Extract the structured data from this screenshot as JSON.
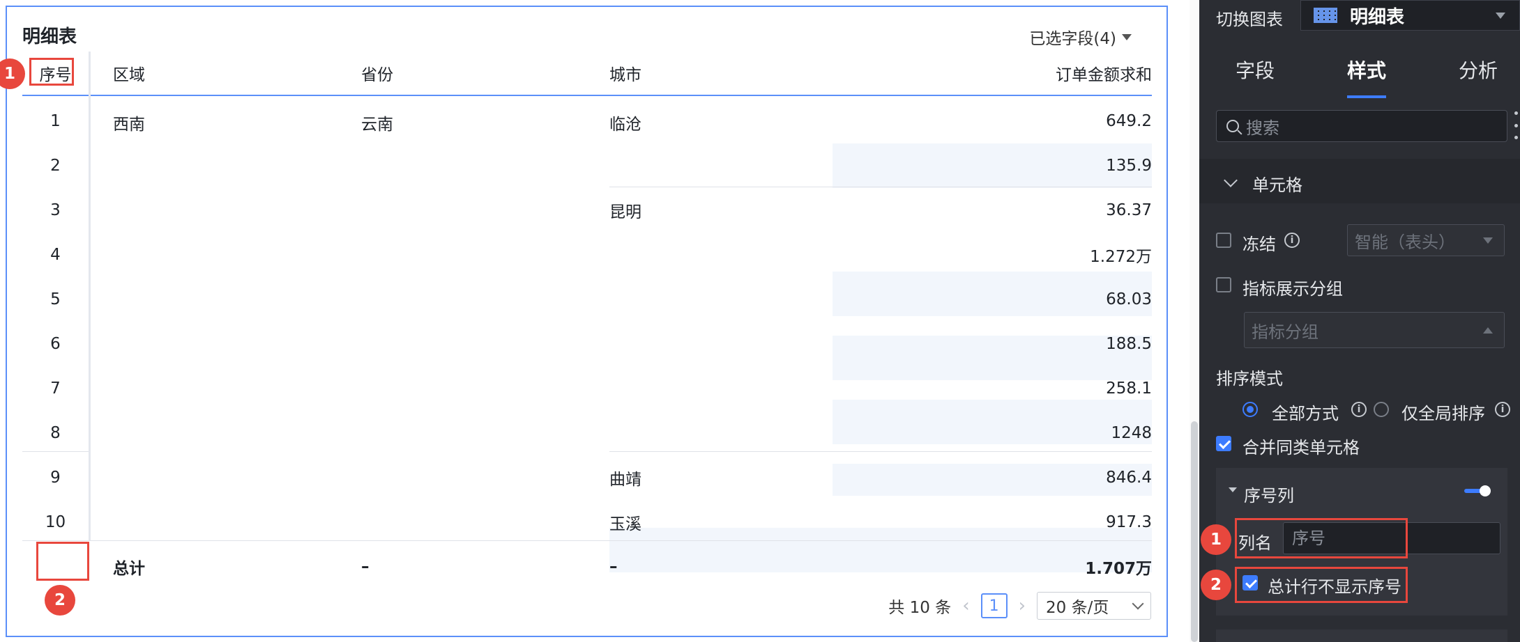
{
  "table": {
    "title": "明细表",
    "fields_selector": "已选字段(4)",
    "headers": {
      "index": "序号",
      "region": "区域",
      "province": "省份",
      "city": "城市",
      "amount": "订单金额求和"
    },
    "rows": [
      {
        "index": "1",
        "region": "西南",
        "province": "云南",
        "city": "临沧",
        "amount": "649.2"
      },
      {
        "index": "2",
        "region": "",
        "province": "",
        "city": "",
        "amount": "135.9"
      },
      {
        "index": "3",
        "region": "",
        "province": "",
        "city": "昆明",
        "amount": "36.37"
      },
      {
        "index": "4",
        "region": "",
        "province": "",
        "city": "",
        "amount": "1.272万"
      },
      {
        "index": "5",
        "region": "",
        "province": "",
        "city": "",
        "amount": "68.03"
      },
      {
        "index": "6",
        "region": "",
        "province": "",
        "city": "",
        "amount": "188.5"
      },
      {
        "index": "7",
        "region": "",
        "province": "",
        "city": "",
        "amount": "258.1"
      },
      {
        "index": "8",
        "region": "",
        "province": "",
        "city": "",
        "amount": "1248"
      },
      {
        "index": "9",
        "region": "",
        "province": "",
        "city": "曲靖",
        "amount": "846.4"
      },
      {
        "index": "10",
        "region": "",
        "province": "",
        "city": "玉溪",
        "amount": "917.3"
      }
    ],
    "total": {
      "label": "总计",
      "province": "–",
      "city": "–",
      "amount": "1.707万"
    },
    "pager": {
      "count": "共 10 条",
      "current": "1",
      "page_size": "20 条/页"
    }
  },
  "markers": {
    "one": "1",
    "two": "2"
  },
  "side": {
    "switch_label": "切换图表",
    "chart_type": "明细表",
    "tabs": [
      "字段",
      "样式",
      "分析"
    ],
    "search_placeholder": "搜索",
    "section": "单元格",
    "freeze_label": "冻结",
    "freeze_value": "智能（表头）",
    "metric_group_label": "指标展示分组",
    "metric_group_placeholder": "指标分组",
    "sort_mode_label": "排序模式",
    "sort_all": "全部方式",
    "sort_global": "仅全局排序",
    "merge_cells_label": "合并同类单元格",
    "index_col_label": "序号列",
    "col_name_label": "列名",
    "col_name_placeholder": "序号",
    "hide_total_index_label": "总计行不显示序号"
  },
  "colors": {
    "accent": "#3d7cff",
    "highlight": "#e8473d",
    "panel_bg": "#2b2d33",
    "border_blue": "#5b8ff9"
  }
}
